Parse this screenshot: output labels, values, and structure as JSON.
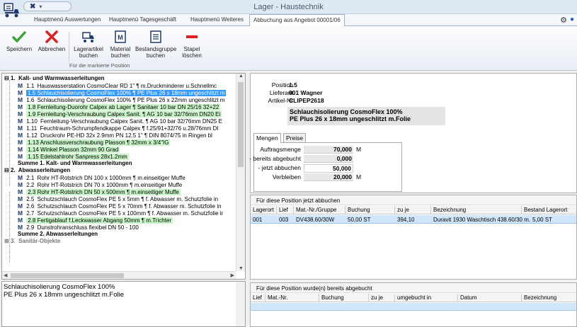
{
  "window": {
    "title": "Lager - Haustechnik"
  },
  "tabs": [
    {
      "label": "Hauptmenü Auswertungen"
    },
    {
      "label": "Hauptmenü Tagesgeschäft"
    },
    {
      "label": "Hauptmenü Weiteres"
    },
    {
      "label": "Abbuchung aus Angebot 00001/06"
    }
  ],
  "ribbon": {
    "buttons": [
      {
        "label1": "Speichern",
        "label2": ""
      },
      {
        "label1": "Abbrechen",
        "label2": ""
      },
      {
        "label1": "Lagerartikel",
        "label2": "buchen"
      },
      {
        "label1": "Material",
        "label2": "buchen"
      },
      {
        "label1": "Bestandsgruppe",
        "label2": "buchen"
      },
      {
        "label1": "Stapel",
        "label2": "löschen"
      }
    ],
    "group_label": "Für die markierte Position",
    "colors": {
      "save": "#3aa43a",
      "cancel": "#e02020",
      "delete": "#e02020"
    }
  },
  "tree": {
    "rows": [
      {
        "num": "1.",
        "text": "Kalt- und Warmwasserleitungen"
      },
      {
        "num": "1.1",
        "text": "Hauswasserstation CosmoClear RD    1\" ¶ m.Druckminderer u.Schnellmc"
      },
      {
        "num": "1.5",
        "text": "Schlauchisolierung CosmoFlex 100% ¶ PE Plus 26 x 18mm ungeschlitzt m"
      },
      {
        "num": "1.6",
        "text": "Schlauchisolierung CosmoFlex 100% ¶ PE Plus 26 x 22mm ungeschlitzt m"
      },
      {
        "num": "1.8",
        "text": "Fernleitung-Duorohr Calpex ab Lager ¶ Sanitaer 10 bar DN 25/16  32+22"
      },
      {
        "num": "1.9",
        "text": "Fernleitung-Verschraubung Calpex Sanit. ¶ AG 10 bar 32/76mm DN20 Ei"
      },
      {
        "num": "1.10",
        "text": "Fernleitung-Verschraubung Calpex Sanit. ¶ AG 10 bar 32/76mm DN25 E"
      },
      {
        "num": "1.11",
        "text": "Feuchtraum-Schrumpfendkappe Calpex ¶ f.25/91+32/76 u.28/76mm DI"
      },
      {
        "num": "1.12",
        "text": "Druckrohr PE-HD  32x 2.9mm PN 12.5    1\" ¶ DIN 8074/75 in Ringen bl"
      },
      {
        "num": "1.13",
        "text": "Anschlussverschraubung Plasson ¶ 32mm x   3/4\"IG"
      },
      {
        "num": "1.14",
        "text": "Winkel Plasson  32mm 90 Grad"
      },
      {
        "num": "1.15",
        "text": "Edelstahlrohr Sanpress 28x1.2mm"
      },
      {
        "num": "",
        "text": "Summe 1. Kalt- und Warmwasserleitungen"
      },
      {
        "num": "2.",
        "text": "Abwasserleitungen"
      },
      {
        "num": "2.1",
        "text": "Rohr HT-Rotstrich DN 100 x 1000mm ¶ m.einseitiger Muffe"
      },
      {
        "num": "2.2",
        "text": "Rohr HT-Rotstrich DN  70 x 1000mm ¶ m.einseitiger Muffe"
      },
      {
        "num": "2.3",
        "text": "Rohr HT-Rotstrich DN  50 x  500mm ¶ m.einseitiger Muffe"
      },
      {
        "num": "2.5",
        "text": "Schutzschlauch CosmoFlex PE 5 x 5mm ¶ f. Abwasser m. Schutzfolie in"
      },
      {
        "num": "2.6",
        "text": "Schutzschlauch CosmoFlex PE 5 x 70mm ¶ f. Abwasser m. Schutzfolie in"
      },
      {
        "num": "2.7",
        "text": "Schutzschlauch CosmoFlex PE 5 x 100mm ¶ f. Abwasser m. Schutzfolie ir"
      },
      {
        "num": "2.8",
        "text": "Fertigablauf f.Leckwasser Abgang 50mm ¶ m.Trichter"
      },
      {
        "num": "2.9",
        "text": "Dunstrohranschluss flexibel DN 50 - 100"
      },
      {
        "num": "",
        "text": "Summe 2. Abwasserleitungen"
      },
      {
        "num": "3.",
        "text": "Sanitär-Objekte"
      }
    ],
    "highlight_color": "#c9f5c9",
    "selection_color": "#3399ff"
  },
  "description": {
    "line1": "Schlauchisolierung CosmoFlex 100%",
    "line2": "PE Plus 26 x 18mm ungeschlitzt m.Folie"
  },
  "info": {
    "position_label": "Position",
    "position_value": "1.5",
    "lieferant_label": "Lieferant",
    "lieferant_value": "001 Wagner",
    "artikel_label": "Artikel-Nr",
    "artikel_value": "CLIPEP2618",
    "art_line1": "Schlauchisolierung CosmoFlex 100%",
    "art_line2": "PE Plus 26 x 18mm ungeschlitzt m.Folie",
    "tab_mengen": "Mengen",
    "tab_preise": "Preise",
    "qty": [
      {
        "label": "Auftragsmenge",
        "value": "70,000",
        "unit": "M"
      },
      {
        "label": "- bereits abgebucht",
        "value": "0,000",
        "unit": ""
      },
      {
        "label": "- jetzt abbuchen",
        "value": "50,000",
        "unit": ""
      },
      {
        "label": "Verbleiben",
        "value": "20,000",
        "unit": "M"
      }
    ]
  },
  "grid1": {
    "title": "Für diese Position jetzt abbuchen",
    "headers": [
      "Lagerort",
      "Lief",
      "Mat.-Nr./Gruppe",
      "Buchung",
      "zu je",
      "Bezeichnung",
      "Bestand Lagerort"
    ],
    "row": [
      "001",
      "003",
      "DV438.60/30W",
      "50,00 ST",
      "394,10",
      "Duravit 1930 Waschtisch 438.60/30 m.",
      "5,00 ST"
    ]
  },
  "grid2": {
    "title": "Für diese Position wurde(n) bereits abgebucht",
    "headers": [
      "Lief",
      "Mat.-Nr.",
      "Buchung",
      "zu je",
      "umgebucht in",
      "Datum",
      "Bezeichnung"
    ]
  }
}
